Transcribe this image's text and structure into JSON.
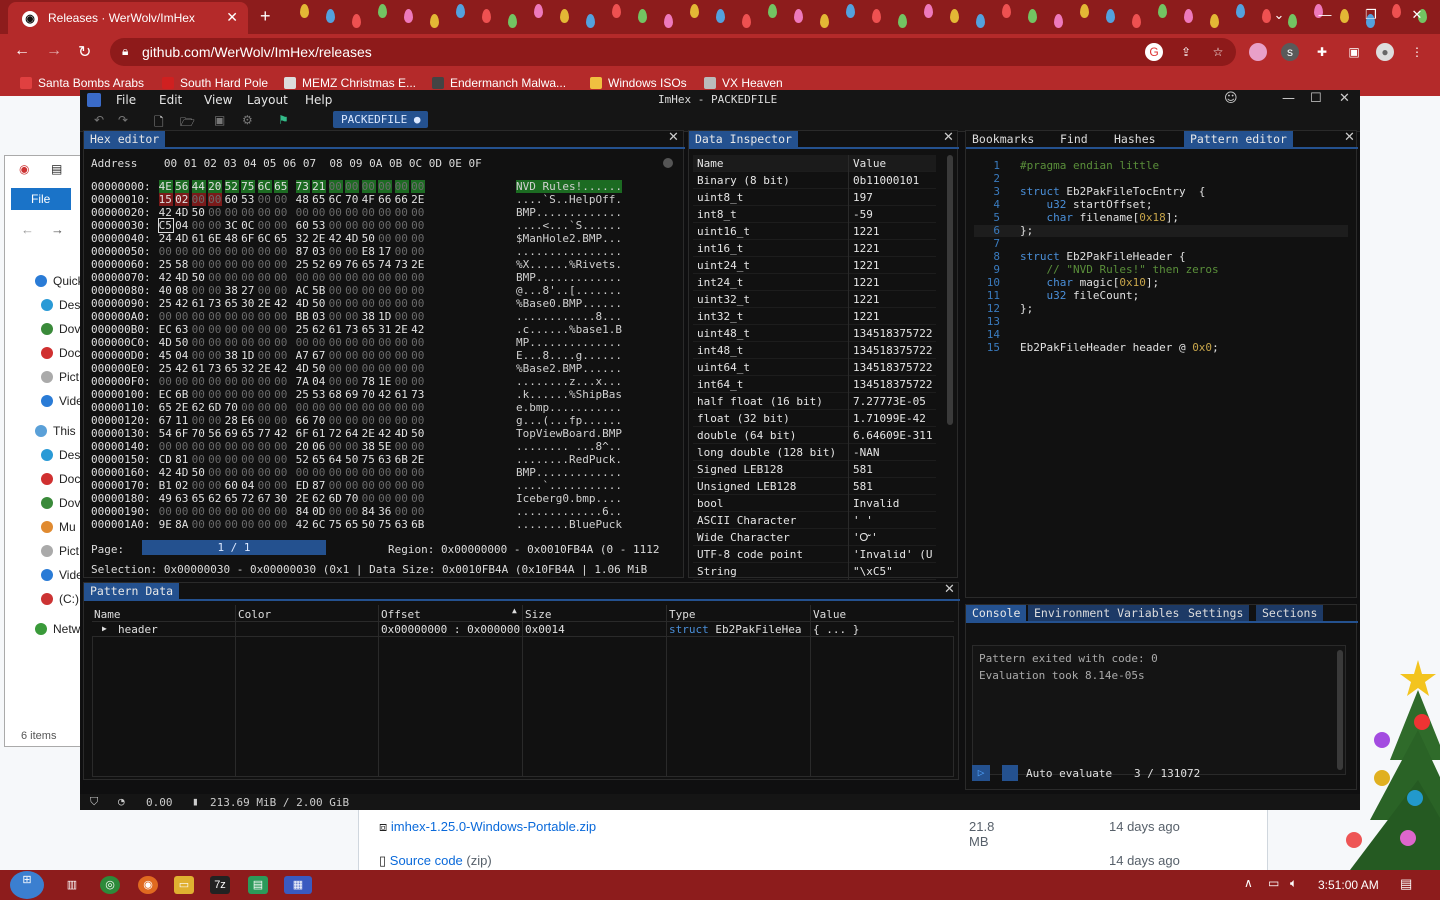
{
  "browser": {
    "tab_title": "Releases · WerWolv/ImHex",
    "url": "github.com/WerWolv/ImHex/releases",
    "bookmarks": [
      "Santa Bombs Arabs",
      "South Hard Pole",
      "MEMZ Christmas E...",
      "Endermanch Malwa...",
      "Windows ISOs",
      "VX Heaven"
    ]
  },
  "github": {
    "assets": [
      {
        "name": "imhex-1.25.0-Windows-Portable.zip",
        "suffix": "",
        "size": "21.8 MB",
        "age": "14 days ago"
      },
      {
        "name": "Source code",
        "suffix": "(zip)",
        "size": "",
        "age": "14 days ago"
      }
    ]
  },
  "explorer": {
    "file_tab": "File",
    "sidebar": [
      "Quick",
      "Des",
      "Dov",
      "Doc",
      "Pict",
      "Vide",
      "This F",
      "Des",
      "Doc",
      "Dov",
      "Mu",
      "Pict",
      "Vide",
      "(C:)",
      "Netw"
    ],
    "count": "6 items"
  },
  "imhex": {
    "menu": [
      "File",
      "Edit",
      "View",
      "Layout",
      "Help"
    ],
    "title": "ImHex - PACKEDFILE",
    "provider_tab": "PACKEDFILE",
    "hex_editor": {
      "tab": "Hex editor",
      "header": "Address    00 01 02 03 04 05 06 07  08 09 0A 0B 0C 0D 0E 0F",
      "rows": [
        {
          "addr": "00000000:",
          "bytes": "4E 56 44 20 52 75 6C 65 73 21 00 00 00 00 00 00",
          "ascii": "NVD Rules!......"
        },
        {
          "addr": "00000010:",
          "bytes": "15 02 00 00 60 53 00 00 48 65 6C 70 4F 66 66 2E",
          "ascii": "....`S..HelpOff."
        },
        {
          "addr": "00000020:",
          "bytes": "42 4D 50 00 00 00 00 00 00 00 00 00 00 00 00 00",
          "ascii": "BMP............."
        },
        {
          "addr": "00000030:",
          "bytes": "C5 04 00 00 3C 0C 00 00 60 53 00 00 00 00 00 00",
          "ascii": "....<...`S......"
        },
        {
          "addr": "00000040:",
          "bytes": "24 4D 61 6E 48 6F 6C 65 32 2E 42 4D 50 00 00 00",
          "ascii": "$ManHole2.BMP..."
        },
        {
          "addr": "00000050:",
          "bytes": "00 00 00 00 00 00 00 00 87 03 00 00 E8 17 00 00",
          "ascii": "................"
        },
        {
          "addr": "00000060:",
          "bytes": "25 58 00 00 00 00 00 00 25 52 69 76 65 74 73 2E",
          "ascii": "%X......%Rivets."
        },
        {
          "addr": "00000070:",
          "bytes": "42 4D 50 00 00 00 00 00 00 00 00 00 00 00 00 00",
          "ascii": "BMP............."
        },
        {
          "addr": "00000080:",
          "bytes": "40 08 00 00 38 27 00 00 AC 5B 00 00 00 00 00 00",
          "ascii": "@...8'..[......."
        },
        {
          "addr": "00000090:",
          "bytes": "25 42 61 73 65 30 2E 42 4D 50 00 00 00 00 00 00",
          "ascii": "%Base0.BMP......"
        },
        {
          "addr": "000000A0:",
          "bytes": "00 00 00 00 00 00 00 00 BB 03 00 00 38 1D 00 00",
          "ascii": "............8..."
        },
        {
          "addr": "000000B0:",
          "bytes": "EC 63 00 00 00 00 00 00 25 62 61 73 65 31 2E 42",
          "ascii": ".c......%base1.B"
        },
        {
          "addr": "000000C0:",
          "bytes": "4D 50 00 00 00 00 00 00 00 00 00 00 00 00 00 00",
          "ascii": "MP.............."
        },
        {
          "addr": "000000D0:",
          "bytes": "45 04 00 00 38 1D 00 00 A7 67 00 00 00 00 00 00",
          "ascii": "E...8....g......"
        },
        {
          "addr": "000000E0:",
          "bytes": "25 42 61 73 65 32 2E 42 4D 50 00 00 00 00 00 00",
          "ascii": "%Base2.BMP......"
        },
        {
          "addr": "000000F0:",
          "bytes": "00 00 00 00 00 00 00 00 7A 04 00 00 78 1E 00 00",
          "ascii": "........z...x..."
        },
        {
          "addr": "00000100:",
          "bytes": "EC 6B 00 00 00 00 00 00 25 53 68 69 70 42 61 73",
          "ascii": ".k......%ShipBas"
        },
        {
          "addr": "00000110:",
          "bytes": "65 2E 62 6D 70 00 00 00 00 00 00 00 00 00 00 00",
          "ascii": "e.bmp..........."
        },
        {
          "addr": "00000120:",
          "bytes": "67 11 00 00 28 E6 00 00 66 70 00 00 00 00 00 00",
          "ascii": "g...(...fp......"
        },
        {
          "addr": "00000130:",
          "bytes": "54 6F 70 56 69 65 77 42 6F 61 72 64 2E 42 4D 50",
          "ascii": "TopViewBoard.BMP"
        },
        {
          "addr": "00000140:",
          "bytes": "00 00 00 00 00 00 00 00 20 06 00 00 38 5E 00 00",
          "ascii": "........ ...8^.."
        },
        {
          "addr": "00000150:",
          "bytes": "CD 81 00 00 00 00 00 00 52 65 64 50 75 63 6B 2E",
          "ascii": "........RedPuck."
        },
        {
          "addr": "00000160:",
          "bytes": "42 4D 50 00 00 00 00 00 00 00 00 00 00 00 00 00",
          "ascii": "BMP............."
        },
        {
          "addr": "00000170:",
          "bytes": "B1 02 00 00 60 04 00 00 ED 87 00 00 00 00 00 00",
          "ascii": "....`..........."
        },
        {
          "addr": "00000180:",
          "bytes": "49 63 65 62 65 72 67 30 2E 62 6D 70 00 00 00 00",
          "ascii": "Iceberg0.bmp...."
        },
        {
          "addr": "00000190:",
          "bytes": "00 00 00 00 00 00 00 00 84 0D 00 00 84 36 00 00",
          "ascii": ".............6.."
        },
        {
          "addr": "000001A0:",
          "bytes": "9E 8A 00 00 00 00 00 00 42 6C 75 65 50 75 63 6B",
          "ascii": "........BluePuck"
        }
      ],
      "page_label": "Page:",
      "page_value": "1 / 1",
      "region": "Region: 0x00000000 - 0x0010FB4A (0 - 1112",
      "selection": "Selection: 0x00000030 - 0x00000030 (0x1 | Data Size: 0x0010FB4A (0x10FB4A | 1.06 MiB"
    },
    "inspector": {
      "tab": "Data Inspector",
      "col_name": "Name",
      "col_value": "Value",
      "rows": [
        [
          "Binary (8 bit)",
          "0b11000101"
        ],
        [
          "uint8_t",
          "197"
        ],
        [
          "int8_t",
          "-59"
        ],
        [
          "uint16_t",
          "1221"
        ],
        [
          "int16_t",
          "1221"
        ],
        [
          "uint24_t",
          "1221"
        ],
        [
          "int24_t",
          "1221"
        ],
        [
          "uint32_t",
          "1221"
        ],
        [
          "int32_t",
          "1221"
        ],
        [
          "uint48_t",
          "134518375722"
        ],
        [
          "int48_t",
          "134518375722"
        ],
        [
          "uint64_t",
          "134518375722"
        ],
        [
          "int64_t",
          "134518375722"
        ],
        [
          "half float (16 bit)",
          "7.27773E-05"
        ],
        [
          "float (32 bit)",
          "1.71099E-42"
        ],
        [
          "double (64 bit)",
          "6.64609E-311"
        ],
        [
          "long double (128 bit)",
          "-NAN"
        ],
        [
          "Signed LEB128",
          "581"
        ],
        [
          "Unsigned LEB128",
          "581"
        ],
        [
          "bool",
          "Invalid"
        ],
        [
          "ASCII Character",
          "' '"
        ],
        [
          "Wide Character",
          "'Ꮕ'"
        ],
        [
          "UTF-8 code point",
          "'Invalid' (U"
        ],
        [
          "String",
          "\"\\xC5\""
        ]
      ]
    },
    "right_tabs": [
      "Bookmarks",
      "Find",
      "Hashes",
      "Pattern editor"
    ],
    "code": [
      {
        "n": "1",
        "parts": [
          [
            "c",
            "#pragma endian little"
          ]
        ]
      },
      {
        "n": "2",
        "parts": []
      },
      {
        "n": "3",
        "parts": [
          [
            "k",
            "struct "
          ],
          [
            "txt",
            "Eb2PakFileTocEntry  {"
          ]
        ]
      },
      {
        "n": "4",
        "parts": [
          [
            "k",
            "    u32 "
          ],
          [
            "txt",
            "startOffset;"
          ]
        ]
      },
      {
        "n": "5",
        "parts": [
          [
            "k",
            "    char "
          ],
          [
            "txt",
            "filename["
          ],
          [
            "num",
            "0x18"
          ],
          [
            "txt",
            "];"
          ]
        ]
      },
      {
        "n": "6",
        "parts": [
          [
            "txt",
            "};"
          ]
        ]
      },
      {
        "n": "7",
        "parts": []
      },
      {
        "n": "8",
        "parts": [
          [
            "k",
            "struct "
          ],
          [
            "txt",
            "Eb2PakFileHeader {"
          ]
        ]
      },
      {
        "n": "9",
        "parts": [
          [
            "c",
            "    // \"NVD Rules!\" then zeros"
          ]
        ]
      },
      {
        "n": "10",
        "parts": [
          [
            "k",
            "    char "
          ],
          [
            "txt",
            "magic["
          ],
          [
            "num",
            "0x10"
          ],
          [
            "txt",
            "];"
          ]
        ]
      },
      {
        "n": "11",
        "parts": [
          [
            "k",
            "    u32 "
          ],
          [
            "txt",
            "fileCount;"
          ]
        ]
      },
      {
        "n": "12",
        "parts": [
          [
            "txt",
            "};"
          ]
        ]
      },
      {
        "n": "13",
        "parts": []
      },
      {
        "n": "14",
        "parts": []
      },
      {
        "n": "15",
        "parts": [
          [
            "txt",
            "Eb2PakFileHeader header @ "
          ],
          [
            "num",
            "0x0"
          ],
          [
            "txt",
            ";"
          ]
        ]
      }
    ],
    "console_tabs": [
      "Console",
      "Environment Variables",
      "Settings",
      "Sections"
    ],
    "console_lines": [
      "Pattern exited with code: 0",
      "Evaluation took 8.14e-05s"
    ],
    "auto_evaluate": "Auto evaluate",
    "eval_count": "3 / 131072",
    "pattern_data": {
      "tab": "Pattern Data",
      "columns": [
        "Name",
        "Color",
        "Offset",
        "Size",
        "Type",
        "Value"
      ],
      "row": {
        "name": "header",
        "offset": "0x00000000 : 0x000000",
        "size": "0x0014",
        "type_kw": "struct",
        "type": "Eb2PakFileHea",
        "value": "{ ... }"
      }
    },
    "status": {
      "fps": "0.00",
      "memory": "213.69 MiB / 2.00 GiB"
    }
  },
  "taskbar": {
    "clock": "3:51:00 AM"
  }
}
